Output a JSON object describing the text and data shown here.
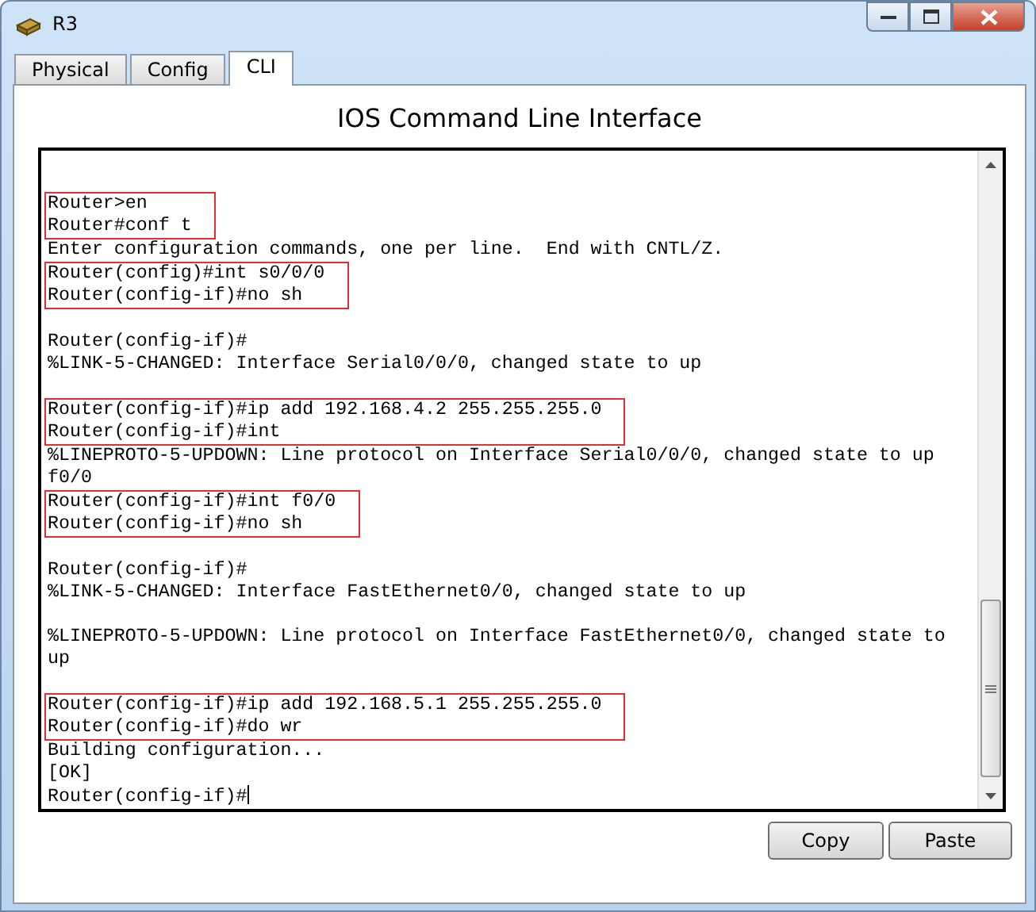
{
  "window": {
    "title": "R3"
  },
  "tabs": [
    {
      "label": "Physical",
      "selected": false
    },
    {
      "label": "Config",
      "selected": false
    },
    {
      "label": "CLI",
      "selected": true
    }
  ],
  "heading": "IOS Command Line Interface",
  "terminal": [
    {
      "kind": "blank"
    },
    {
      "kind": "boxed",
      "lines": [
        "Router>en",
        "Router#conf t"
      ]
    },
    {
      "kind": "plain",
      "lines": [
        "Enter configuration commands, one per line.  End with CNTL/Z."
      ]
    },
    {
      "kind": "boxed",
      "lines": [
        "Router(config)#int s0/0/0",
        "Router(config-if)#no sh"
      ]
    },
    {
      "kind": "blank"
    },
    {
      "kind": "plain",
      "lines": [
        "Router(config-if)#",
        "%LINK-5-CHANGED: Interface Serial0/0/0, changed state to up"
      ]
    },
    {
      "kind": "blank"
    },
    {
      "kind": "boxed",
      "lines": [
        "Router(config-if)#ip add 192.168.4.2 255.255.255.0",
        "Router(config-if)#int"
      ]
    },
    {
      "kind": "plain",
      "lines": [
        "%LINEPROTO-5-UPDOWN: Line protocol on Interface Serial0/0/0, changed state to up",
        "f0/0"
      ]
    },
    {
      "kind": "boxed",
      "lines": [
        "Router(config-if)#int f0/0",
        "Router(config-if)#no sh"
      ]
    },
    {
      "kind": "blank"
    },
    {
      "kind": "plain",
      "lines": [
        "Router(config-if)#",
        "%LINK-5-CHANGED: Interface FastEthernet0/0, changed state to up"
      ]
    },
    {
      "kind": "blank"
    },
    {
      "kind": "plain",
      "lines": [
        "%LINEPROTO-5-UPDOWN: Line protocol on Interface FastEthernet0/0, changed state to",
        "up"
      ]
    },
    {
      "kind": "blank"
    },
    {
      "kind": "boxed",
      "lines": [
        "Router(config-if)#ip add 192.168.5.1 255.255.255.0",
        "Router(config-if)#do wr"
      ]
    },
    {
      "kind": "plain",
      "lines": [
        "Building configuration...",
        "[OK]"
      ]
    },
    {
      "kind": "prompt",
      "lines": [
        "Router(config-if)#"
      ]
    }
  ],
  "buttons": [
    "Copy",
    "Paste"
  ]
}
